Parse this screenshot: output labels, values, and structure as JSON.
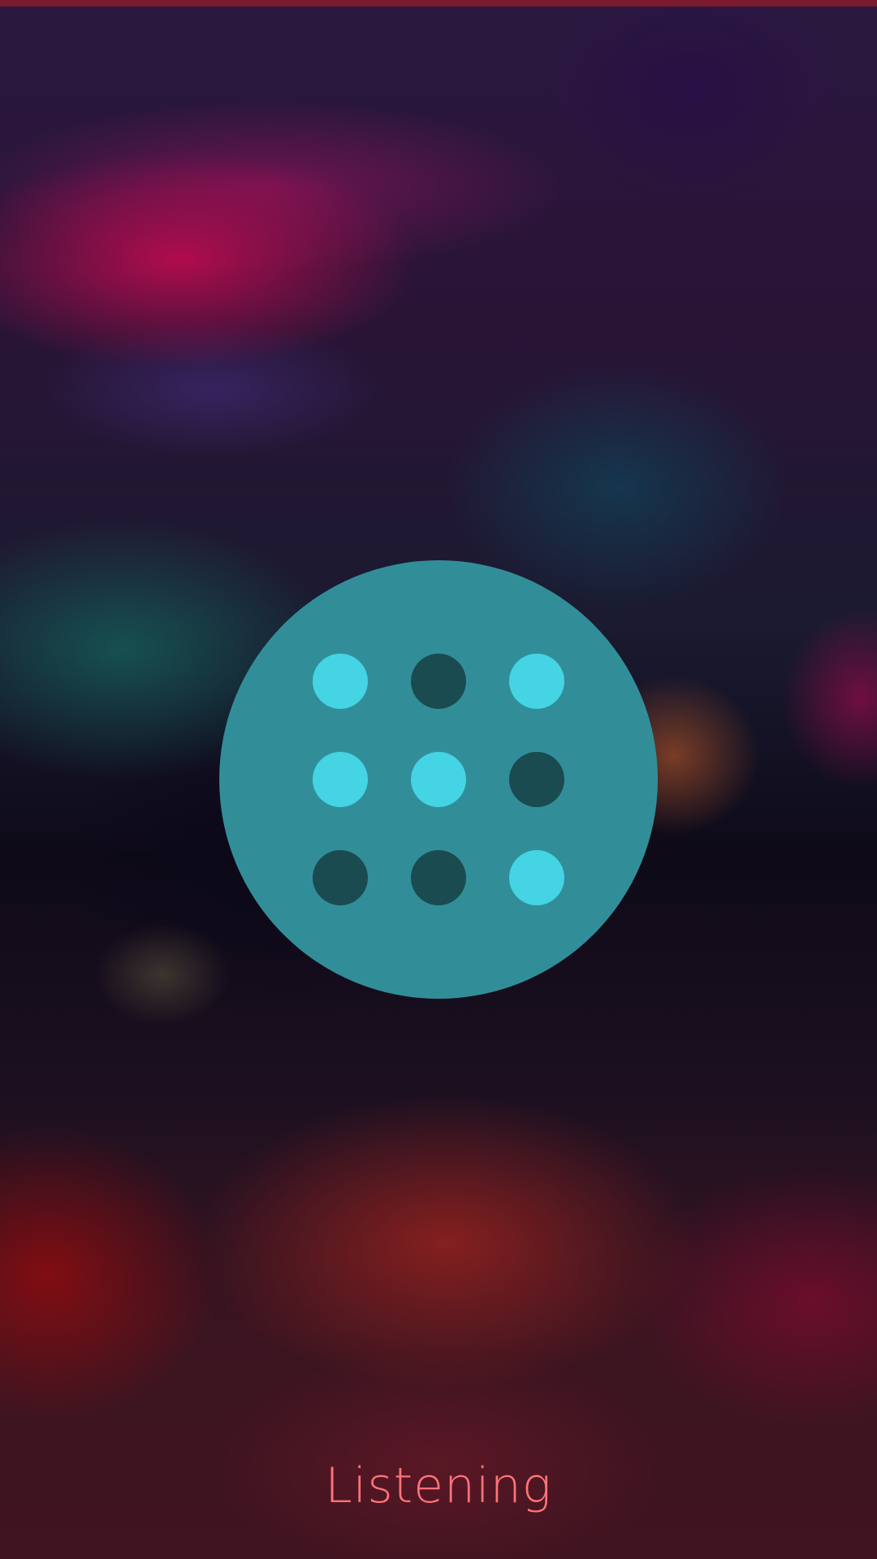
{
  "status": {
    "label": "Listening"
  },
  "colors": {
    "top_bar": "#7a1a2c",
    "button_fill": "#318e99",
    "dot_active": "#44d4e4",
    "dot_inactive": "#1a4b50",
    "status_text": "#ff7378"
  },
  "icon": {
    "name": "voice-activity-dot-grid-icon",
    "dots": [
      {
        "active": true
      },
      {
        "active": false
      },
      {
        "active": true
      },
      {
        "active": true
      },
      {
        "active": true
      },
      {
        "active": false
      },
      {
        "active": false
      },
      {
        "active": false
      },
      {
        "active": true
      }
    ]
  }
}
